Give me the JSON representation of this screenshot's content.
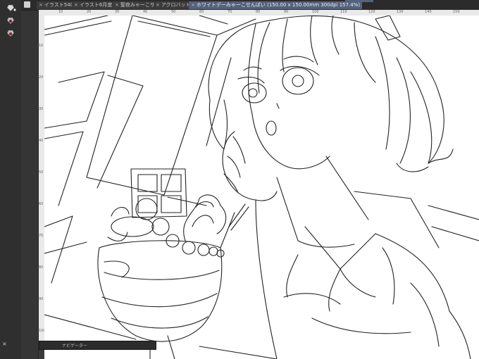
{
  "tabs": [
    {
      "label": "イラスト540度"
    },
    {
      "label": "イラスト6月度"
    },
    {
      "label": "聖夜みゃーこサ"
    },
    {
      "label": "アクロバット"
    },
    {
      "label": "ホワイトデーみゃーこせんぱい (150.00 x 150.00mm 300dpi 157.4%)"
    }
  ],
  "rulers": {
    "top": [
      "10",
      "20",
      "30",
      "40",
      "50",
      "60",
      "70",
      "80",
      "90",
      "100",
      "110",
      "120",
      "130",
      "140",
      "150"
    ],
    "left": [
      "10",
      "20",
      "30",
      "40",
      "50",
      "60",
      "70",
      "80",
      "90",
      "100"
    ]
  },
  "navigator": {
    "label": "ナビゲーター"
  },
  "colors": {
    "active_tab": "#55607a",
    "panel_dark": "#2f2f2f"
  }
}
